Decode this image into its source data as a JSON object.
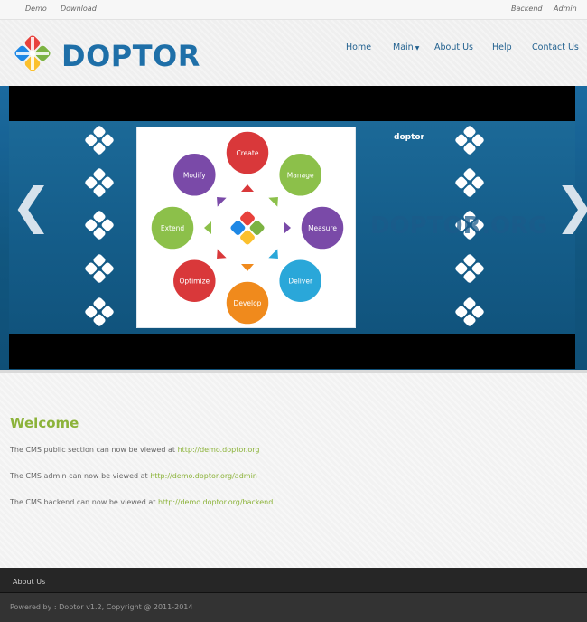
{
  "topbar": {
    "left_links": [
      "Demo",
      "Download"
    ],
    "right_links": [
      "Backend",
      "Admin"
    ]
  },
  "header": {
    "brand": "DOPTOR",
    "nav": [
      {
        "label": "Home",
        "dropdown": false
      },
      {
        "label": "Main",
        "dropdown": true
      },
      {
        "label": "About Us",
        "dropdown": false
      },
      {
        "label": "Help",
        "dropdown": false
      },
      {
        "label": "Contact Us",
        "dropdown": false
      }
    ]
  },
  "slider": {
    "prev_glyph": "❮",
    "next_glyph": "❯",
    "tag": "doptor",
    "watermark": "DOPTOR.ORG",
    "diagram_nodes": [
      {
        "label": "Create",
        "color": "#d9383a"
      },
      {
        "label": "Manage",
        "color": "#8cc04a"
      },
      {
        "label": "Measure",
        "color": "#7a4aa8"
      },
      {
        "label": "Deliver",
        "color": "#2aa7d9"
      },
      {
        "label": "Develop",
        "color": "#f08a1c"
      },
      {
        "label": "Optimize",
        "color": "#d9383a"
      },
      {
        "label": "Extend",
        "color": "#8cc04a"
      },
      {
        "label": "Modify",
        "color": "#7a4aa8"
      }
    ]
  },
  "content": {
    "heading": "Welcome",
    "lines": [
      {
        "text": "The CMS public section can now be viewed at ",
        "link": "http://demo.doptor.org"
      },
      {
        "text": "The CMS admin can now be viewed at ",
        "link": "http://demo.doptor.org/admin"
      },
      {
        "text": "The CMS backend can now be viewed at ",
        "link": "http://demo.doptor.org/backend"
      }
    ]
  },
  "footer": {
    "nav_label": "About Us",
    "copyright": "Powered by : Doptor v1.2, Copyright @ 2011-2014"
  },
  "colors": {
    "brand_blue": "#1e6fa8",
    "accent_green": "#8cb33a",
    "slider_blue": "#155e8b"
  }
}
